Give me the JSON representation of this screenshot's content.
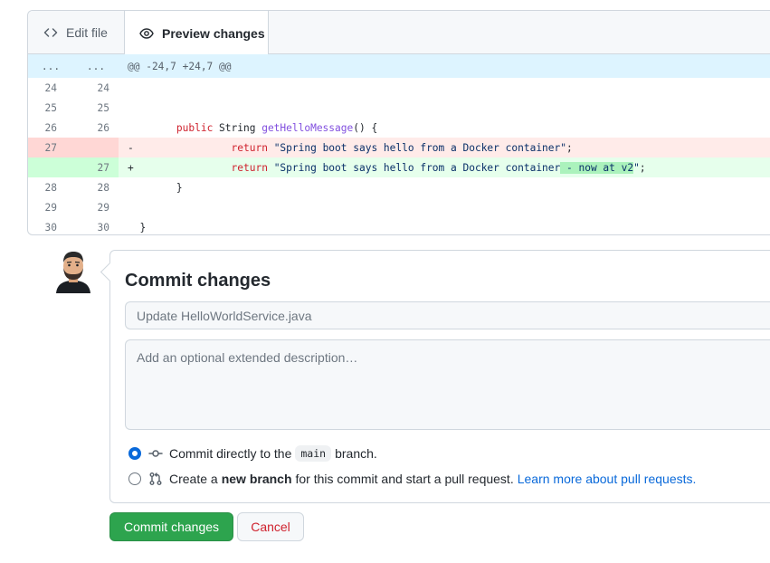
{
  "tabs": {
    "edit_label": "Edit file",
    "preview_label": "Preview changes"
  },
  "diff": {
    "hunk": {
      "left": "...",
      "right": "...",
      "text": "@@ -24,7 +24,7 @@"
    },
    "rows": [
      {
        "type": "ctx",
        "old": "24",
        "new": "24"
      },
      {
        "type": "ctx",
        "old": "25",
        "new": "25"
      },
      {
        "type": "ctx",
        "old": "26",
        "new": "26",
        "indent": "        ",
        "kw": "public",
        "type_name": " String ",
        "fn": "getHelloMessage",
        "rest": "() {"
      },
      {
        "type": "del",
        "old": "27",
        "new": "",
        "marker": "-",
        "indent": "                ",
        "kw": "return",
        "str": " \"Spring boot says hello from a Docker container\"",
        "rest": ";"
      },
      {
        "type": "add",
        "old": "",
        "new": "27",
        "marker": "+",
        "indent": "                ",
        "kw": "return",
        "str": " \"Spring boot says hello from a Docker container",
        "hl": " - now at v2",
        "str_end": "\"",
        "rest": ";"
      },
      {
        "type": "ctx",
        "old": "28",
        "new": "28",
        "indent": "        ",
        "rest": "}"
      },
      {
        "type": "ctx",
        "old": "29",
        "new": "29"
      },
      {
        "type": "ctx",
        "old": "30",
        "new": "30",
        "indent": "  ",
        "rest": "}"
      }
    ]
  },
  "commit": {
    "title": "Commit changes",
    "summary_placeholder": "Update HelloWorldService.java",
    "description_placeholder": "Add an optional extended description…",
    "option_direct": {
      "text_before": "Commit directly to the",
      "branch": "main",
      "text_after": "branch."
    },
    "option_new_branch": {
      "text_before": "Create a",
      "bold": "new branch",
      "text_after": "for this commit and start a pull request.",
      "link": "Learn more about pull requests."
    },
    "selected_option": "direct"
  },
  "buttons": {
    "commit_label": "Commit changes",
    "cancel_label": "Cancel"
  },
  "colors": {
    "accent": "#0969da",
    "commit_button": "#2da44e",
    "cancel_text": "#cf222e",
    "deletion_bg": "#ffebe9",
    "addition_bg": "#e6ffec",
    "addition_highlight": "#abf2bc",
    "hunk_bg": "#ddf4ff"
  }
}
